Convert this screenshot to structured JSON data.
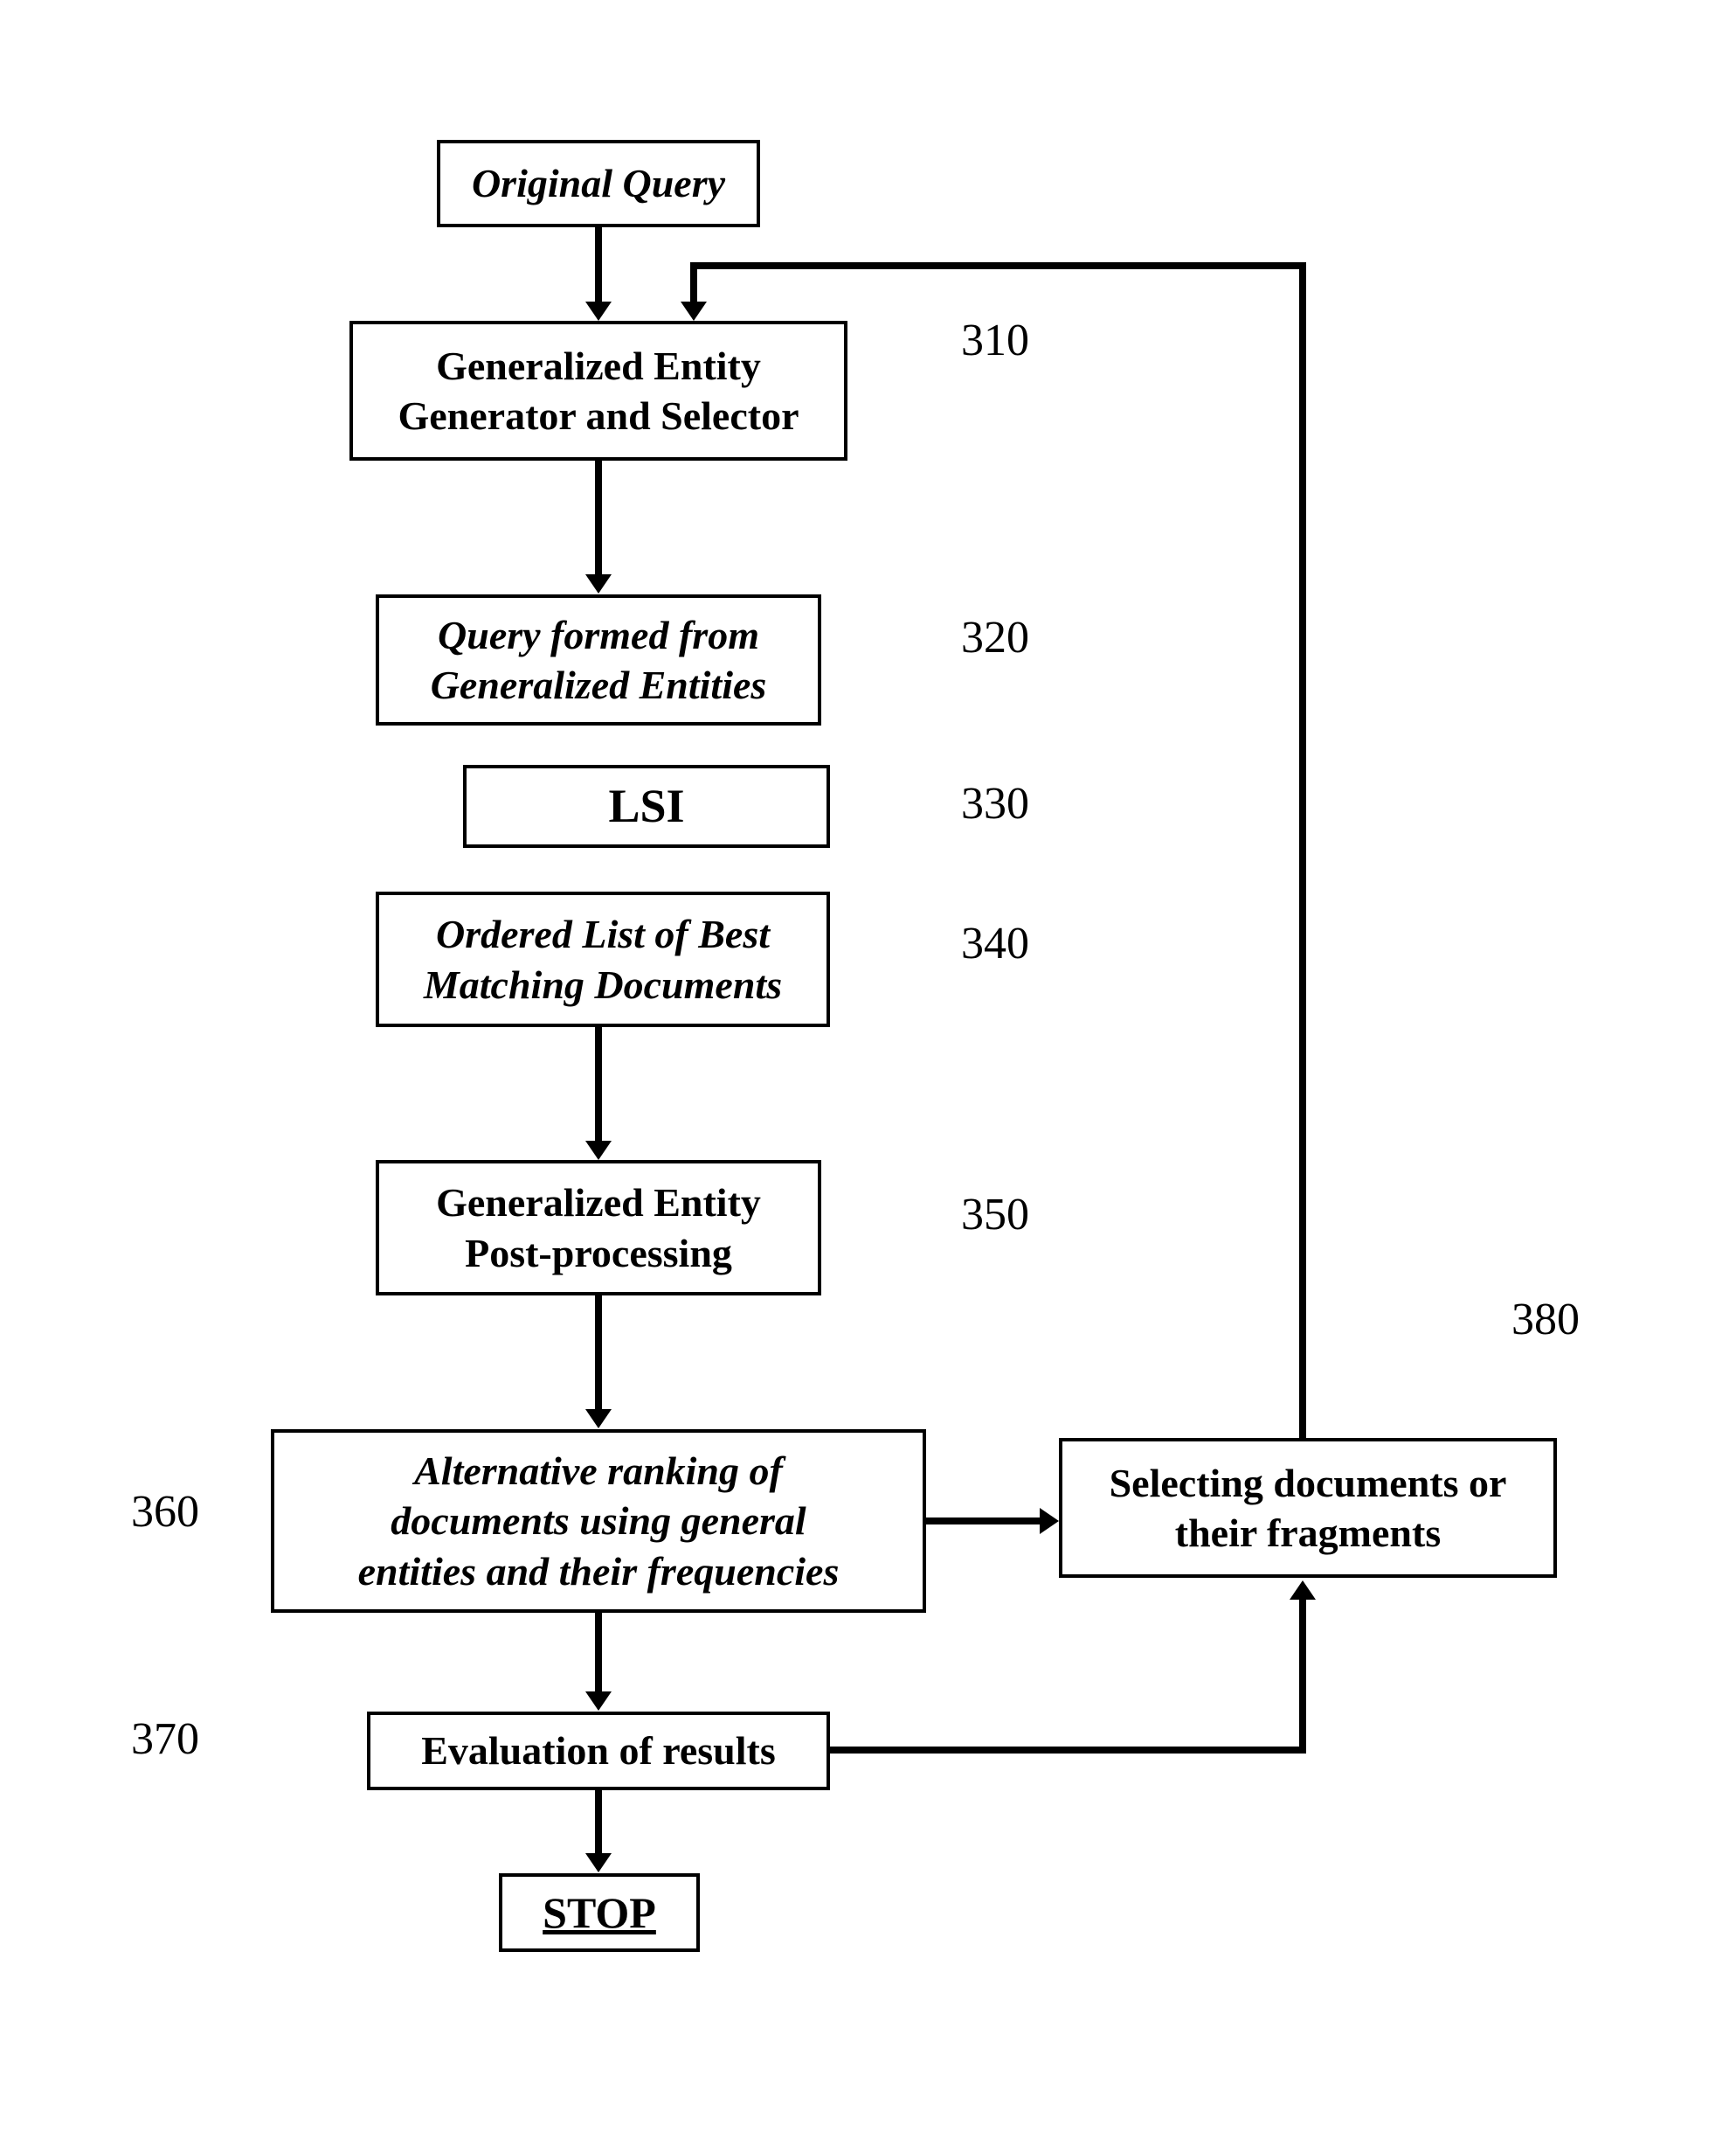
{
  "boxes": {
    "original_query": "Original Query",
    "generator_selector_line1": "Generalized Entity",
    "generator_selector_line2": "Generator and Selector",
    "query_formed_line1": "Query formed from",
    "query_formed_line2": "Generalized Entities",
    "lsi": "LSI",
    "ordered_list_line1": "Ordered List of Best",
    "ordered_list_line2": "Matching Documents",
    "post_processing_line1": "Generalized Entity",
    "post_processing_line2": "Post-processing",
    "alt_ranking_line1": "Alternative ranking of",
    "alt_ranking_line2": "documents using general",
    "alt_ranking_line3": "entities and their frequencies",
    "evaluation": "Evaluation of results",
    "selecting_line1": "Selecting documents or",
    "selecting_line2": "their fragments",
    "stop": "STOP"
  },
  "labels": {
    "l310": "310",
    "l320": "320",
    "l330": "330",
    "l340": "340",
    "l350": "350",
    "l360": "360",
    "l370": "370",
    "l380": "380"
  }
}
